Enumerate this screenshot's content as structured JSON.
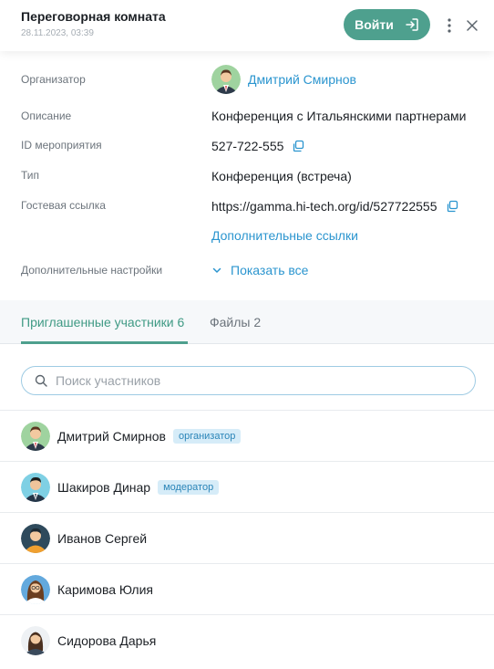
{
  "header": {
    "title": "Переговорная комната",
    "subtitle": "28.11.2023, 03:39",
    "join_label": "Войти",
    "icons": {
      "join": "login-icon",
      "more": "more-vertical-icon",
      "close": "close-icon"
    },
    "accent": "#4ea08e"
  },
  "details": {
    "organizer": {
      "label": "Организатор",
      "value": "Дмитрий Смирнов"
    },
    "description": {
      "label": "Описание",
      "value": "Конференция с Итальянскими партнерами"
    },
    "event_id": {
      "label": "ID мероприятия",
      "value": "527-722-555"
    },
    "type": {
      "label": "Тип",
      "value": "Конференция (встреча)"
    },
    "guest_link": {
      "label": "Гостевая ссылка",
      "value": "https://gamma.hi-tech.org/id/527722555",
      "more_links": "Дополнительные ссылки"
    },
    "extra_settings": {
      "label": "Дополнительные настройки",
      "value": "Показать все"
    },
    "link_color": "#2b95cf"
  },
  "tabs": [
    {
      "label": "Приглашенные участники 6",
      "active": true
    },
    {
      "label": "Файлы 2",
      "active": false
    }
  ],
  "search": {
    "placeholder": "Поиск участников",
    "value": ""
  },
  "participants": [
    {
      "name": "Дмитрий Смирнов",
      "badge": "организатор",
      "avatar": "avatar-man-suit-icon"
    },
    {
      "name": "Шакиров Динар",
      "badge": "модератор",
      "avatar": "avatar-man-tie-icon"
    },
    {
      "name": "Иванов Сергей",
      "badge": "",
      "avatar": "avatar-man-orange-icon"
    },
    {
      "name": "Каримова Юлия",
      "badge": "",
      "avatar": "avatar-woman-glasses-icon"
    },
    {
      "name": "Сидорова Дарья",
      "badge": "",
      "avatar": "avatar-woman-icon"
    }
  ]
}
